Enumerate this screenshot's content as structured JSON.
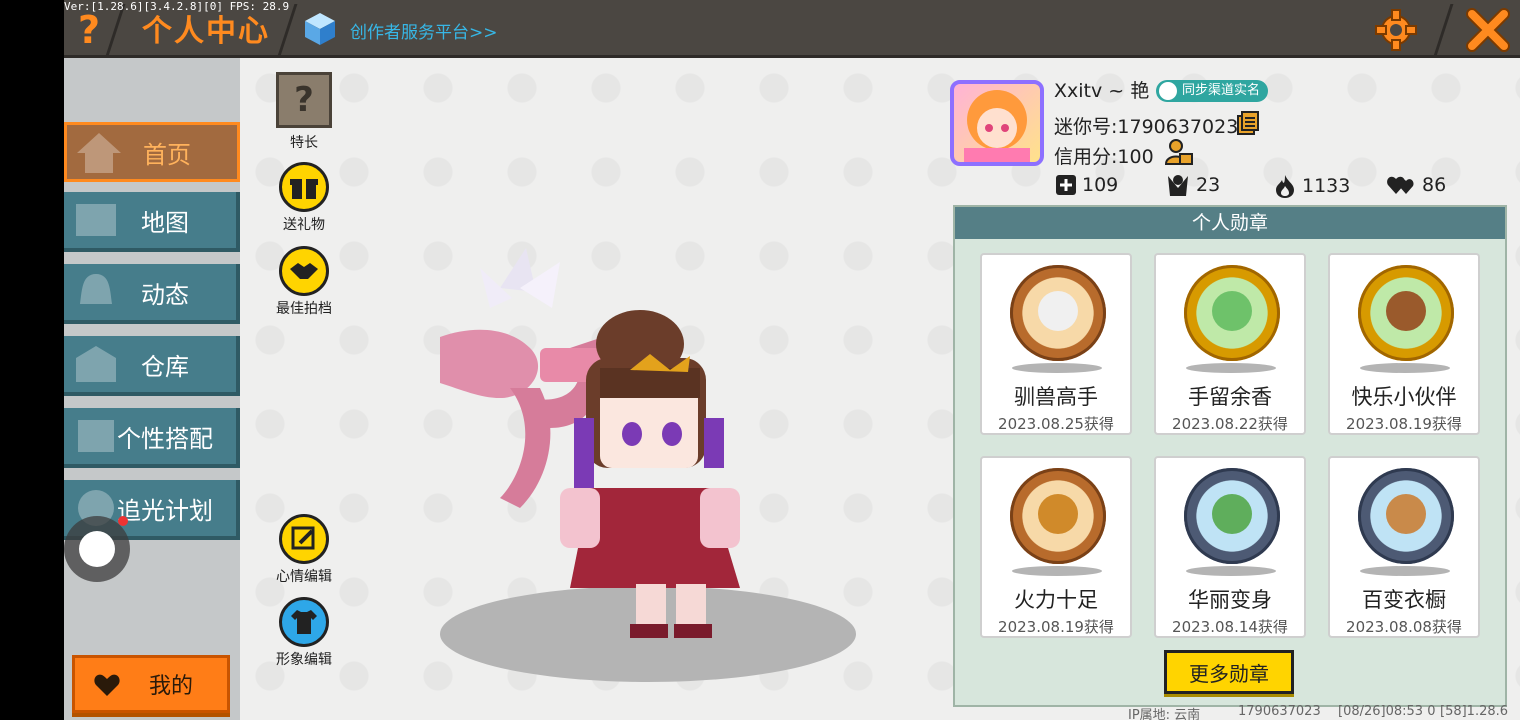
{
  "debug": {
    "version_text": "Ver:[1.28.6][3.4.2.8][0] FPS: 28.9"
  },
  "header": {
    "help_glyph": "?",
    "title": "个人中心",
    "creator_link": "创作者服务平台>>",
    "icons": {
      "settings": "gear-icon",
      "close": "close-icon",
      "creator": "cube-icon"
    },
    "accent_color": "#ff8a1f"
  },
  "sidebar": {
    "items": [
      {
        "label": "首页",
        "icon": "home-icon",
        "active": true
      },
      {
        "label": "地图",
        "icon": "map-icon",
        "active": false
      },
      {
        "label": "动态",
        "icon": "bell-icon",
        "active": false
      },
      {
        "label": "仓库",
        "icon": "warehouse-icon",
        "active": false
      },
      {
        "label": "个性搭配",
        "icon": "outfit-icon",
        "active": false
      },
      {
        "label": "追光计划",
        "icon": "spotlight-icon",
        "active": false
      }
    ],
    "my_button": "我的"
  },
  "actions": {
    "specialty_glyph": "?",
    "specialty": "特长",
    "gift": "送礼物",
    "partner": "最佳拍档",
    "mood_edit": "心情编辑",
    "avatar_edit": "形象编辑"
  },
  "profile": {
    "username": "Xxitv ~ 艳",
    "verify_badge": "同步渠道实名",
    "mini_id": "迷你号:1790637023",
    "credit": "信用分:100",
    "stats": [
      {
        "icon": "plus-icon",
        "value": "109"
      },
      {
        "icon": "fans-icon",
        "value": "23"
      },
      {
        "icon": "flame-icon",
        "value": "1133"
      },
      {
        "icon": "hearts-icon",
        "value": "86"
      }
    ]
  },
  "medals": {
    "header": "个人勋章",
    "items": [
      {
        "name": "驯兽高手",
        "date": "2023.08.25获得",
        "tier": "bronze"
      },
      {
        "name": "手留余香",
        "date": "2023.08.22获得",
        "tier": "gold"
      },
      {
        "name": "快乐小伙伴",
        "date": "2023.08.19获得",
        "tier": "gold"
      },
      {
        "name": "火力十足",
        "date": "2023.08.19获得",
        "tier": "bronze"
      },
      {
        "name": "华丽变身",
        "date": "2023.08.14获得",
        "tier": "silver"
      },
      {
        "name": "百变衣橱",
        "date": "2023.08.08获得",
        "tier": "silver"
      }
    ],
    "more_button": "更多勋章"
  },
  "footer": {
    "ip": "IP属地: 云南",
    "uid": "1790637023",
    "time": "[08/26]08:53 0",
    "build": "[58]1.28.6"
  }
}
